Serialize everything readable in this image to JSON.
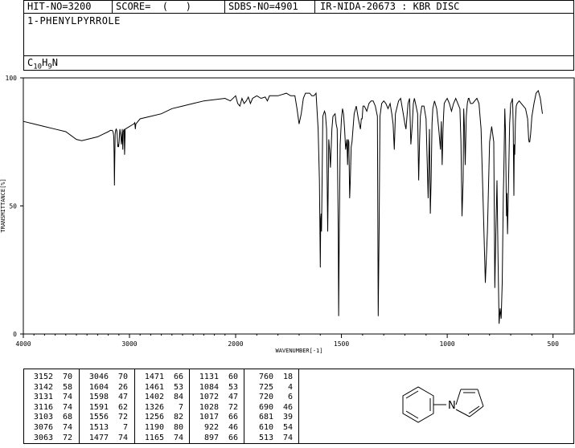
{
  "header": {
    "hit_no": "HIT-NO=3200",
    "score": "SCORE=  (   )",
    "sdbs_no": "SDBS-NO=4901",
    "ir_label": "IR-NIDA-20673 : KBR DISC",
    "compound_name": "1-PHENYLPYRROLE",
    "formula": {
      "C": "C",
      "c_count": "10",
      "H": "H",
      "h_count": "9",
      "N": "N"
    }
  },
  "chart_data": {
    "type": "line",
    "xlabel": "WAVENUMBER[-1]",
    "ylabel": "TRANSMITTANCE[%]",
    "xlim": [
      4000,
      400
    ],
    "ylim": [
      0,
      100
    ],
    "x_ticks": [
      "4000",
      "3000",
      "2000",
      "1500",
      "1000",
      "500"
    ],
    "y_ticks": [
      "100",
      "50",
      "0"
    ],
    "grid": false,
    "line_color": "#000000",
    "spectrum": {
      "x": [
        4000,
        3900,
        3800,
        3700,
        3600,
        3500,
        3450,
        3400,
        3300,
        3250,
        3200,
        3180,
        3162,
        3155,
        3152,
        3148,
        3145,
        3142,
        3139,
        3135,
        3130,
        3125,
        3120,
        3116,
        3110,
        3106,
        3103,
        3098,
        3090,
        3080,
        3076,
        3072,
        3068,
        3063,
        3058,
        3050,
        3046,
        3040,
        3000,
        2980,
        2960,
        2950,
        2945,
        2940,
        2900,
        2800,
        2700,
        2600,
        2500,
        2400,
        2300,
        2200,
        2100,
        2050,
        2000,
        1990,
        1980,
        1970,
        1960,
        1950,
        1940,
        1930,
        1920,
        1900,
        1880,
        1860,
        1850,
        1840,
        1830,
        1800,
        1780,
        1760,
        1740,
        1720,
        1710,
        1700,
        1690,
        1680,
        1670,
        1660,
        1650,
        1640,
        1630,
        1620,
        1610,
        1604,
        1600,
        1598,
        1596,
        1594,
        1591,
        1588,
        1580,
        1576,
        1570,
        1565,
        1560,
        1556,
        1552,
        1545,
        1540,
        1530,
        1525,
        1520,
        1515,
        1513,
        1510,
        1506,
        1500,
        1495,
        1490,
        1485,
        1480,
        1477,
        1474,
        1471,
        1468,
        1465,
        1461,
        1458,
        1454,
        1450,
        1440,
        1430,
        1420,
        1410,
        1406,
        1402,
        1398,
        1392,
        1380,
        1370,
        1360,
        1350,
        1340,
        1330,
        1326,
        1322,
        1318,
        1310,
        1300,
        1290,
        1280,
        1270,
        1262,
        1256,
        1250,
        1245,
        1230,
        1220,
        1210,
        1200,
        1195,
        1190,
        1185,
        1178,
        1172,
        1165,
        1160,
        1155,
        1150,
        1140,
        1135,
        1131,
        1127,
        1120,
        1110,
        1100,
        1090,
        1084,
        1080,
        1076,
        1072,
        1068,
        1060,
        1050,
        1040,
        1032,
        1028,
        1024,
        1020,
        1017,
        1014,
        1008,
        1000,
        990,
        980,
        970,
        960,
        950,
        940,
        935,
        930,
        925,
        922,
        919,
        915,
        910,
        905,
        900,
        897,
        894,
        890,
        880,
        870,
        860,
        850,
        840,
        830,
        820,
        810,
        800,
        790,
        780,
        775,
        770,
        765,
        760,
        755,
        750,
        745,
        740,
        735,
        732,
        728,
        725,
        722,
        720,
        718,
        715,
        710,
        705,
        700,
        695,
        692,
        690,
        688,
        685,
        683,
        681,
        678,
        674,
        670,
        660,
        650,
        640,
        630,
        620,
        615,
        613,
        610,
        606,
        600,
        590,
        580,
        570,
        560,
        550,
        540,
        530,
        525,
        522,
        520,
        515,
        510,
        500,
        480,
        460,
        440,
        420,
        400
      ],
      "y": [
        83,
        82,
        81,
        80,
        79,
        76,
        75.5,
        76,
        77,
        78,
        79,
        79.5,
        79.5,
        79,
        78.5,
        77,
        70,
        58,
        68,
        78,
        79.5,
        80,
        79.5,
        78,
        73,
        74,
        73,
        75,
        80,
        77,
        74,
        76,
        80,
        72,
        79,
        80,
        70,
        80,
        81,
        81.5,
        82,
        82.5,
        80,
        82,
        84,
        85,
        86,
        88,
        89,
        90,
        91,
        91.5,
        92,
        91,
        93,
        90,
        89,
        92,
        90,
        91,
        92.5,
        90,
        92,
        93,
        92,
        92.5,
        91,
        93,
        93,
        93,
        93.5,
        94,
        93,
        93,
        88,
        82,
        86,
        92,
        94,
        94,
        94,
        93,
        93,
        94,
        80,
        60,
        26,
        45,
        47,
        40,
        62,
        85,
        87,
        86,
        80,
        40,
        76,
        72,
        65,
        80,
        85,
        86,
        82,
        80,
        40,
        7,
        40,
        74,
        84,
        88,
        86,
        80,
        72,
        74,
        76,
        66,
        76,
        75,
        53,
        60,
        73,
        75,
        86,
        89,
        84,
        80,
        84,
        84,
        89,
        89,
        87,
        90,
        91,
        91,
        89,
        85,
        7,
        40,
        85,
        90,
        91,
        90,
        88,
        90,
        86,
        82,
        72,
        86,
        91,
        92,
        87,
        82,
        80,
        85,
        90,
        92,
        74,
        82,
        90,
        92,
        90,
        86,
        60,
        75,
        85,
        89,
        89,
        84,
        53,
        80,
        47,
        60,
        82,
        88,
        91,
        88,
        80,
        72,
        83,
        66,
        80,
        86,
        90,
        91,
        92,
        90,
        87,
        90,
        92,
        90,
        88,
        75,
        46,
        60,
        88,
        82,
        66,
        85,
        90,
        92,
        92,
        91,
        90,
        90,
        91,
        92,
        90,
        80,
        50,
        20,
        40,
        75,
        81,
        75,
        18,
        40,
        60,
        30,
        4,
        10,
        6,
        20,
        55,
        65,
        88,
        80,
        60,
        46,
        55,
        39,
        60,
        82,
        90,
        91,
        92,
        88,
        80,
        54,
        74,
        70,
        83,
        89,
        90,
        91,
        90,
        89,
        88,
        84,
        76,
        75,
        75,
        78,
        85,
        90,
        94,
        95,
        92,
        86
      ]
    },
    "peaks": [
      {
        "wavenumber": "3152",
        "t": "70"
      },
      {
        "wavenumber": "3142",
        "t": "58"
      },
      {
        "wavenumber": "3131",
        "t": "74"
      },
      {
        "wavenumber": "3116",
        "t": "74"
      },
      {
        "wavenumber": "3103",
        "t": "68"
      },
      {
        "wavenumber": "3076",
        "t": "74"
      },
      {
        "wavenumber": "3063",
        "t": "72"
      },
      {
        "wavenumber": "3046",
        "t": "70"
      },
      {
        "wavenumber": "1604",
        "t": "26"
      },
      {
        "wavenumber": "1598",
        "t": "47"
      },
      {
        "wavenumber": "1591",
        "t": "62"
      },
      {
        "wavenumber": "1556",
        "t": "72"
      },
      {
        "wavenumber": "1513",
        "t": "7"
      },
      {
        "wavenumber": "1477",
        "t": "74"
      },
      {
        "wavenumber": "1471",
        "t": "66"
      },
      {
        "wavenumber": "1461",
        "t": "53"
      },
      {
        "wavenumber": "1402",
        "t": "84"
      },
      {
        "wavenumber": "1326",
        "t": "7"
      },
      {
        "wavenumber": "1256",
        "t": "82"
      },
      {
        "wavenumber": "1190",
        "t": "80"
      },
      {
        "wavenumber": "1165",
        "t": "74"
      },
      {
        "wavenumber": "1131",
        "t": "60"
      },
      {
        "wavenumber": "1084",
        "t": "53"
      },
      {
        "wavenumber": "1072",
        "t": "47"
      },
      {
        "wavenumber": "1028",
        "t": "72"
      },
      {
        "wavenumber": "1017",
        "t": "66"
      },
      {
        "wavenumber": "922",
        "t": "46"
      },
      {
        "wavenumber": "897",
        "t": "66"
      },
      {
        "wavenumber": "760",
        "t": "18"
      },
      {
        "wavenumber": "725",
        "t": "4"
      },
      {
        "wavenumber": "720",
        "t": "6"
      },
      {
        "wavenumber": "690",
        "t": "46"
      },
      {
        "wavenumber": "681",
        "t": "39"
      },
      {
        "wavenumber": "610",
        "t": "54"
      },
      {
        "wavenumber": "513",
        "t": "74"
      }
    ]
  },
  "structure": {
    "atom_label": "N",
    "molecule": "1-phenylpyrrole"
  }
}
